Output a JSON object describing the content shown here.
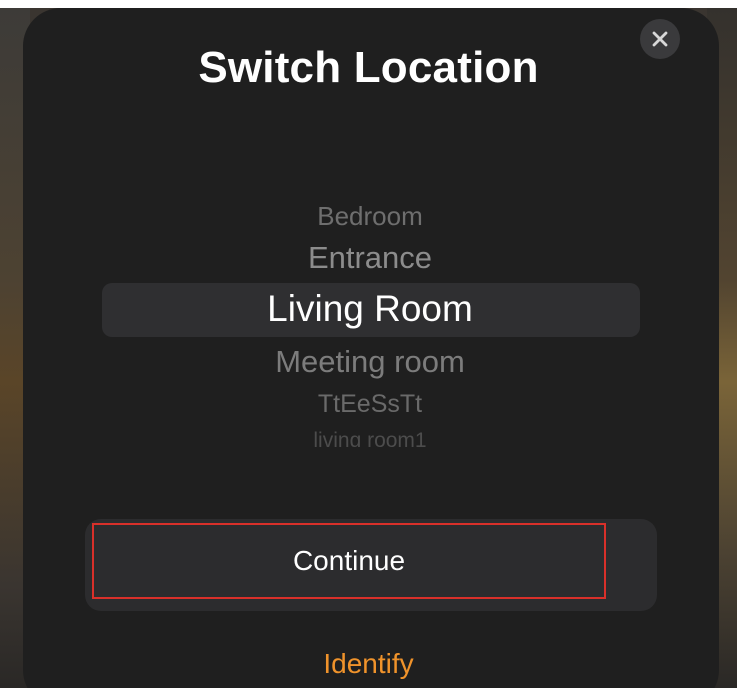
{
  "dialog": {
    "title": "Switch Location",
    "close_icon": "close-icon"
  },
  "picker": {
    "items": [
      {
        "label": "Bedroom"
      },
      {
        "label": "Entrance"
      },
      {
        "label": "Living Room",
        "selected": true
      },
      {
        "label": "Meeting room"
      },
      {
        "label": "TtEeSsTt"
      },
      {
        "label": "living room1"
      }
    ]
  },
  "actions": {
    "continue_label": "Continue",
    "identify_label": "Identify"
  },
  "colors": {
    "sheet_background": "#1f1f1f",
    "accent": "#f0932b",
    "highlight_border": "#d9302a",
    "text_primary": "#ffffff"
  }
}
